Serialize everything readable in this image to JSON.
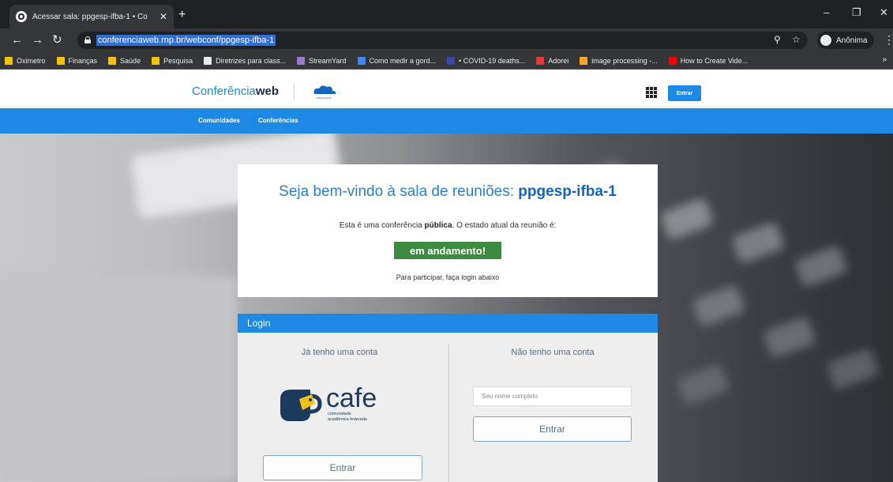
{
  "browser": {
    "tab_title": "Acessar sala: ppgesp-ifba-1 • Co",
    "tab_close": "✕",
    "new_tab": "+",
    "window_controls": {
      "minimize": "–",
      "maximize": "❐",
      "close": "✕"
    },
    "url": "conferenciaweb.rnp.br/webconf/ppgesp-ifba-1",
    "profile_label": "Anônima",
    "bookmarks": [
      {
        "label": "Oximetro",
        "icon": "folder-icon",
        "color": "#f4c20d"
      },
      {
        "label": "Finanças",
        "icon": "folder-icon",
        "color": "#f4c20d"
      },
      {
        "label": "Saúde",
        "icon": "folder-icon",
        "color": "#f4c20d"
      },
      {
        "label": "Pesquisa",
        "icon": "folder-icon",
        "color": "#f4c20d"
      },
      {
        "label": "Diretrizes para class...",
        "icon": "globe-icon",
        "color": "#e8eaed"
      },
      {
        "label": "StreamYard",
        "icon": "streamyard-icon",
        "color": "#9b7bd1"
      },
      {
        "label": "Como medir a gord...",
        "icon": "site-icon",
        "color": "#4285f4"
      },
      {
        "label": "• COVID-19 deaths...",
        "icon": "site-icon",
        "color": "#3949ab"
      },
      {
        "label": "Adorei",
        "icon": "site-icon",
        "color": "#e53935"
      },
      {
        "label": "image processing -...",
        "icon": "site-icon",
        "color": "#f9a825"
      },
      {
        "label": "How to Create Vide...",
        "icon": "youtube-icon",
        "color": "#ff0000"
      }
    ],
    "bookmarks_more": "»"
  },
  "site": {
    "logo_part1": "Conferência",
    "logo_part2": "web",
    "logo_partner": "nasnuvens",
    "header_login": "Entrar",
    "nav": [
      "Comunidades",
      "Conferências"
    ],
    "brand_color": "#1e88e5"
  },
  "welcome": {
    "title_prefix": "Seja bem-vindo à sala de reuniões: ",
    "room": "ppgesp-ifba-1",
    "desc_prefix": "Esta é uma conferência ",
    "desc_bold": "pública",
    "desc_suffix": ". O estado atual da reunião é:",
    "status": "em andamento!",
    "status_color": "#3d8b40",
    "hint": "Para participar, faça login abaixo"
  },
  "login": {
    "header": "Login",
    "has_account_title": "Já tenho uma conta",
    "cafe_word": "cafe",
    "cafe_subtitle_1": "comunidade",
    "cafe_subtitle_2": "acadêmica federada",
    "has_account_button": "Entrar",
    "no_account_title": "Não tenho uma conta",
    "name_placeholder": "Seu nome completo",
    "no_account_button": "Entrar"
  }
}
